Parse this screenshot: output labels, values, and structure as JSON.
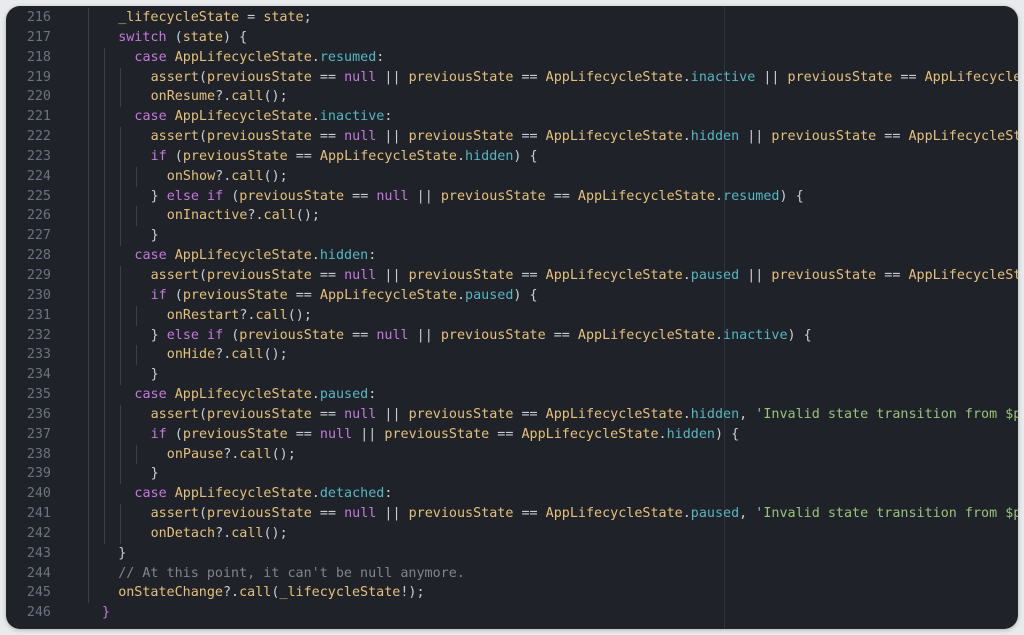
{
  "editor": {
    "theme_colors": {
      "background": "#1f2229",
      "keyword": "#c678dd",
      "type": "#e5c07b",
      "property": "#56b6c2",
      "string": "#98c379",
      "comment": "#7f848e",
      "plain": "#c9cdd4",
      "line_number": "#6b7280"
    },
    "lines": [
      {
        "n": "216",
        "indent": 1,
        "tokens": [
          [
            "var",
            "_lifecycleState"
          ],
          [
            "op",
            " = "
          ],
          [
            "var",
            "state"
          ],
          [
            "pun",
            ";"
          ]
        ]
      },
      {
        "n": "217",
        "indent": 1,
        "tokens": [
          [
            "kw",
            "switch"
          ],
          [
            "pun",
            " ("
          ],
          [
            "var",
            "state"
          ],
          [
            "pun",
            ") {"
          ]
        ]
      },
      {
        "n": "218",
        "indent": 2,
        "tokens": [
          [
            "kw",
            "case "
          ],
          [
            "type",
            "AppLifecycleState"
          ],
          [
            "pun",
            "."
          ],
          [
            "prop",
            "resumed"
          ],
          [
            "pun",
            ":"
          ]
        ]
      },
      {
        "n": "219",
        "indent": 3,
        "tokens": [
          [
            "fn",
            "assert"
          ],
          [
            "pun",
            "("
          ],
          [
            "var",
            "previousState"
          ],
          [
            "op",
            " == "
          ],
          [
            "null",
            "null"
          ],
          [
            "op",
            " || "
          ],
          [
            "var",
            "previousState"
          ],
          [
            "op",
            " == "
          ],
          [
            "type",
            "AppLifecycleState"
          ],
          [
            "pun",
            "."
          ],
          [
            "prop",
            "inactive"
          ],
          [
            "op",
            " || "
          ],
          [
            "var",
            "previousState"
          ],
          [
            "op",
            " == "
          ],
          [
            "type",
            "AppLifecycleSt"
          ]
        ]
      },
      {
        "n": "220",
        "indent": 3,
        "tokens": [
          [
            "fn",
            "onResume"
          ],
          [
            "pun",
            "?."
          ],
          [
            "fn",
            "call"
          ],
          [
            "pun",
            "();"
          ]
        ]
      },
      {
        "n": "221",
        "indent": 2,
        "tokens": [
          [
            "kw",
            "case "
          ],
          [
            "type",
            "AppLifecycleState"
          ],
          [
            "pun",
            "."
          ],
          [
            "prop",
            "inactive"
          ],
          [
            "pun",
            ":"
          ]
        ]
      },
      {
        "n": "222",
        "indent": 3,
        "tokens": [
          [
            "fn",
            "assert"
          ],
          [
            "pun",
            "("
          ],
          [
            "var",
            "previousState"
          ],
          [
            "op",
            " == "
          ],
          [
            "null",
            "null"
          ],
          [
            "op",
            " || "
          ],
          [
            "var",
            "previousState"
          ],
          [
            "op",
            " == "
          ],
          [
            "type",
            "AppLifecycleState"
          ],
          [
            "pun",
            "."
          ],
          [
            "prop",
            "hidden"
          ],
          [
            "op",
            " || "
          ],
          [
            "var",
            "previousState"
          ],
          [
            "op",
            " == "
          ],
          [
            "type",
            "AppLifecycleStat"
          ]
        ]
      },
      {
        "n": "223",
        "indent": 3,
        "tokens": [
          [
            "kw",
            "if"
          ],
          [
            "pun",
            " ("
          ],
          [
            "var",
            "previousState"
          ],
          [
            "op",
            " == "
          ],
          [
            "type",
            "AppLifecycleState"
          ],
          [
            "pun",
            "."
          ],
          [
            "prop",
            "hidden"
          ],
          [
            "pun",
            ") {"
          ]
        ]
      },
      {
        "n": "224",
        "indent": 4,
        "tokens": [
          [
            "fn",
            "onShow"
          ],
          [
            "pun",
            "?."
          ],
          [
            "fn",
            "call"
          ],
          [
            "pun",
            "();"
          ]
        ]
      },
      {
        "n": "225",
        "indent": 3,
        "tokens": [
          [
            "pun",
            "} "
          ],
          [
            "kw",
            "else if"
          ],
          [
            "pun",
            " ("
          ],
          [
            "var",
            "previousState"
          ],
          [
            "op",
            " == "
          ],
          [
            "null",
            "null"
          ],
          [
            "op",
            " || "
          ],
          [
            "var",
            "previousState"
          ],
          [
            "op",
            " == "
          ],
          [
            "type",
            "AppLifecycleState"
          ],
          [
            "pun",
            "."
          ],
          [
            "prop",
            "resumed"
          ],
          [
            "pun",
            ") {"
          ]
        ]
      },
      {
        "n": "226",
        "indent": 4,
        "tokens": [
          [
            "fn",
            "onInactive"
          ],
          [
            "pun",
            "?."
          ],
          [
            "fn",
            "call"
          ],
          [
            "pun",
            "();"
          ]
        ]
      },
      {
        "n": "227",
        "indent": 3,
        "tokens": [
          [
            "pun",
            "}"
          ]
        ]
      },
      {
        "n": "228",
        "indent": 2,
        "tokens": [
          [
            "kw",
            "case "
          ],
          [
            "type",
            "AppLifecycleState"
          ],
          [
            "pun",
            "."
          ],
          [
            "prop",
            "hidden"
          ],
          [
            "pun",
            ":"
          ]
        ]
      },
      {
        "n": "229",
        "indent": 3,
        "tokens": [
          [
            "fn",
            "assert"
          ],
          [
            "pun",
            "("
          ],
          [
            "var",
            "previousState"
          ],
          [
            "op",
            " == "
          ],
          [
            "null",
            "null"
          ],
          [
            "op",
            " || "
          ],
          [
            "var",
            "previousState"
          ],
          [
            "op",
            " == "
          ],
          [
            "type",
            "AppLifecycleState"
          ],
          [
            "pun",
            "."
          ],
          [
            "prop",
            "paused"
          ],
          [
            "op",
            " || "
          ],
          [
            "var",
            "previousState"
          ],
          [
            "op",
            " == "
          ],
          [
            "type",
            "AppLifecycleStat"
          ]
        ]
      },
      {
        "n": "230",
        "indent": 3,
        "tokens": [
          [
            "kw",
            "if"
          ],
          [
            "pun",
            " ("
          ],
          [
            "var",
            "previousState"
          ],
          [
            "op",
            " == "
          ],
          [
            "type",
            "AppLifecycleState"
          ],
          [
            "pun",
            "."
          ],
          [
            "prop",
            "paused"
          ],
          [
            "pun",
            ") {"
          ]
        ]
      },
      {
        "n": "231",
        "indent": 4,
        "tokens": [
          [
            "fn",
            "onRestart"
          ],
          [
            "pun",
            "?."
          ],
          [
            "fn",
            "call"
          ],
          [
            "pun",
            "();"
          ]
        ]
      },
      {
        "n": "232",
        "indent": 3,
        "tokens": [
          [
            "pun",
            "} "
          ],
          [
            "kw",
            "else if"
          ],
          [
            "pun",
            " ("
          ],
          [
            "var",
            "previousState"
          ],
          [
            "op",
            " == "
          ],
          [
            "null",
            "null"
          ],
          [
            "op",
            " || "
          ],
          [
            "var",
            "previousState"
          ],
          [
            "op",
            " == "
          ],
          [
            "type",
            "AppLifecycleState"
          ],
          [
            "pun",
            "."
          ],
          [
            "prop",
            "inactive"
          ],
          [
            "pun",
            ") {"
          ]
        ]
      },
      {
        "n": "233",
        "indent": 4,
        "tokens": [
          [
            "fn",
            "onHide"
          ],
          [
            "pun",
            "?."
          ],
          [
            "fn",
            "call"
          ],
          [
            "pun",
            "();"
          ]
        ]
      },
      {
        "n": "234",
        "indent": 3,
        "tokens": [
          [
            "pun",
            "}"
          ]
        ]
      },
      {
        "n": "235",
        "indent": 2,
        "tokens": [
          [
            "kw",
            "case "
          ],
          [
            "type",
            "AppLifecycleState"
          ],
          [
            "pun",
            "."
          ],
          [
            "prop",
            "paused"
          ],
          [
            "pun",
            ":"
          ]
        ]
      },
      {
        "n": "236",
        "indent": 3,
        "tokens": [
          [
            "fn",
            "assert"
          ],
          [
            "pun",
            "("
          ],
          [
            "var",
            "previousState"
          ],
          [
            "op",
            " == "
          ],
          [
            "null",
            "null"
          ],
          [
            "op",
            " || "
          ],
          [
            "var",
            "previousState"
          ],
          [
            "op",
            " == "
          ],
          [
            "type",
            "AppLifecycleState"
          ],
          [
            "pun",
            "."
          ],
          [
            "prop",
            "hidden"
          ],
          [
            "pun",
            ", "
          ],
          [
            "str",
            "'Invalid state transition from $pre"
          ]
        ]
      },
      {
        "n": "237",
        "indent": 3,
        "tokens": [
          [
            "kw",
            "if"
          ],
          [
            "pun",
            " ("
          ],
          [
            "var",
            "previousState"
          ],
          [
            "op",
            " == "
          ],
          [
            "null",
            "null"
          ],
          [
            "op",
            " || "
          ],
          [
            "var",
            "previousState"
          ],
          [
            "op",
            " == "
          ],
          [
            "type",
            "AppLifecycleState"
          ],
          [
            "pun",
            "."
          ],
          [
            "prop",
            "hidden"
          ],
          [
            "pun",
            ") {"
          ]
        ]
      },
      {
        "n": "238",
        "indent": 4,
        "tokens": [
          [
            "fn",
            "onPause"
          ],
          [
            "pun",
            "?."
          ],
          [
            "fn",
            "call"
          ],
          [
            "pun",
            "();"
          ]
        ]
      },
      {
        "n": "239",
        "indent": 3,
        "tokens": [
          [
            "pun",
            "}"
          ]
        ]
      },
      {
        "n": "240",
        "indent": 2,
        "tokens": [
          [
            "kw",
            "case "
          ],
          [
            "type",
            "AppLifecycleState"
          ],
          [
            "pun",
            "."
          ],
          [
            "prop",
            "detached"
          ],
          [
            "pun",
            ":"
          ]
        ]
      },
      {
        "n": "241",
        "indent": 3,
        "tokens": [
          [
            "fn",
            "assert"
          ],
          [
            "pun",
            "("
          ],
          [
            "var",
            "previousState"
          ],
          [
            "op",
            " == "
          ],
          [
            "null",
            "null"
          ],
          [
            "op",
            " || "
          ],
          [
            "var",
            "previousState"
          ],
          [
            "op",
            " == "
          ],
          [
            "type",
            "AppLifecycleState"
          ],
          [
            "pun",
            "."
          ],
          [
            "prop",
            "paused"
          ],
          [
            "pun",
            ", "
          ],
          [
            "str",
            "'Invalid state transition from $pre"
          ]
        ]
      },
      {
        "n": "242",
        "indent": 3,
        "tokens": [
          [
            "fn",
            "onDetach"
          ],
          [
            "pun",
            "?."
          ],
          [
            "fn",
            "call"
          ],
          [
            "pun",
            "();"
          ]
        ]
      },
      {
        "n": "243",
        "indent": 1,
        "tokens": [
          [
            "pun",
            "}"
          ]
        ]
      },
      {
        "n": "244",
        "indent": 1,
        "tokens": [
          [
            "cm",
            "// At this point, it can't be null anymore."
          ]
        ]
      },
      {
        "n": "245",
        "indent": 1,
        "tokens": [
          [
            "fn",
            "onStateChange"
          ],
          [
            "pun",
            "?."
          ],
          [
            "fn",
            "call"
          ],
          [
            "pun",
            "("
          ],
          [
            "var",
            "_lifecycleState"
          ],
          [
            "pun",
            "!);"
          ]
        ]
      },
      {
        "n": "246",
        "indent": 0,
        "tokens": [
          [
            "kw",
            "}"
          ]
        ]
      }
    ]
  }
}
